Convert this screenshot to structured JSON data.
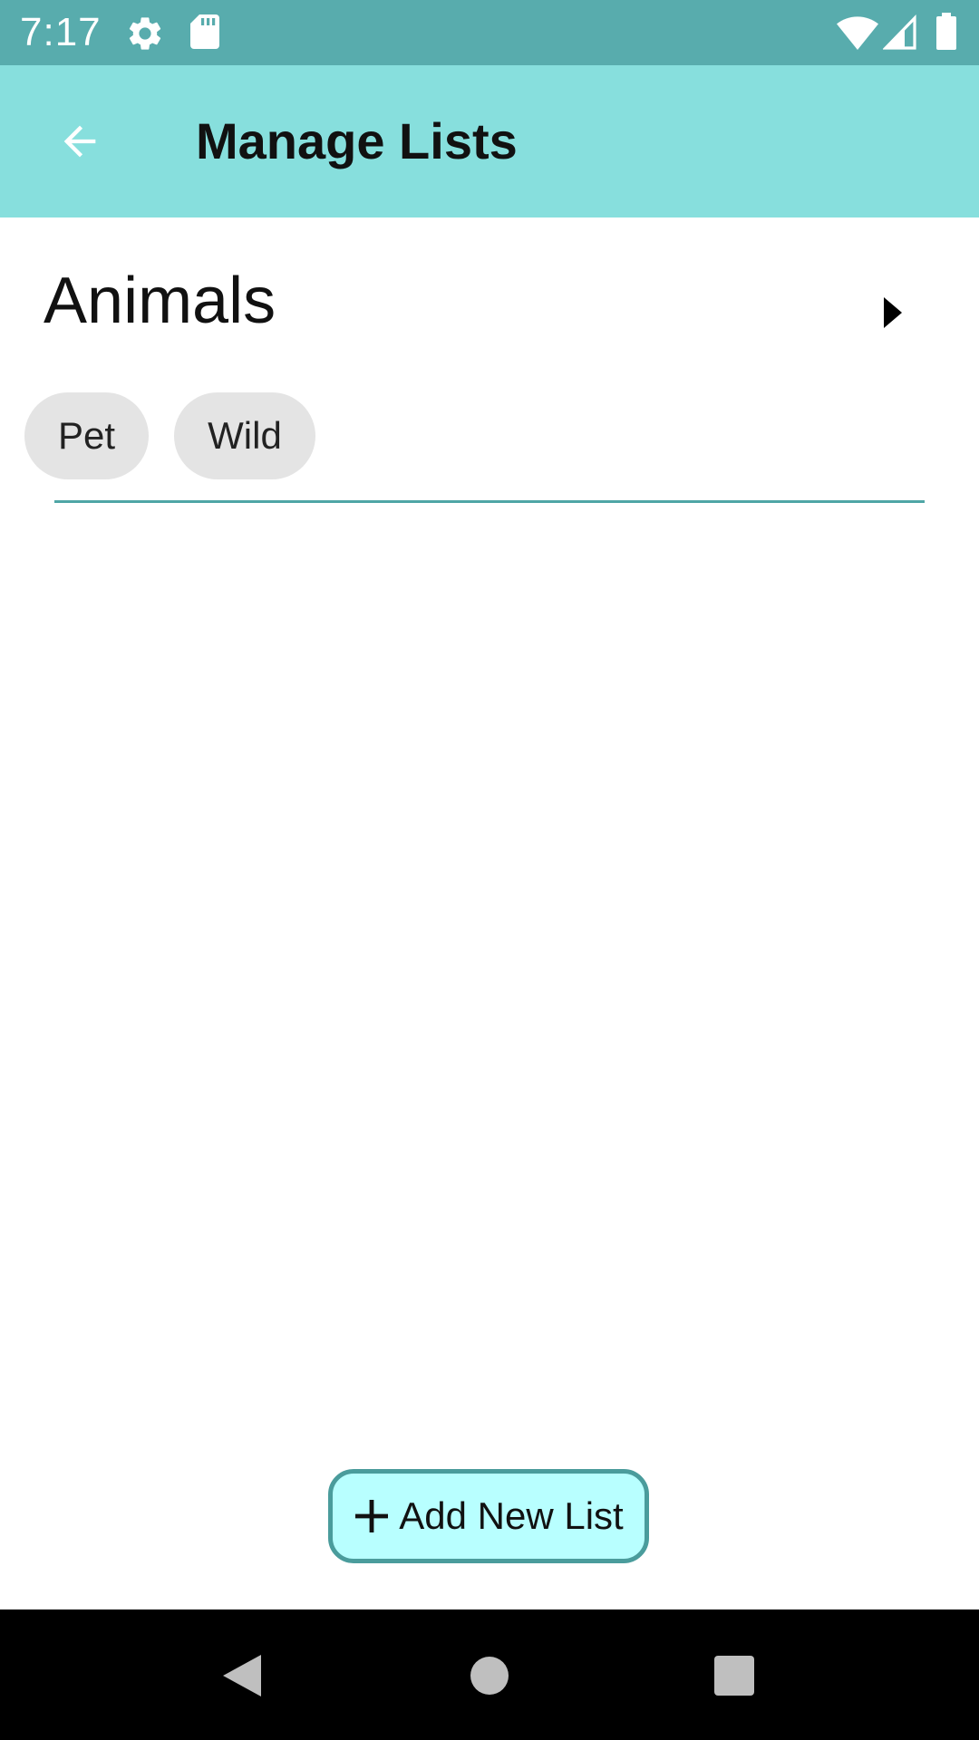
{
  "status_bar": {
    "time": "7:17",
    "icons": [
      "settings-icon",
      "sd-card-icon",
      "wifi-icon",
      "signal-icon",
      "battery-icon"
    ],
    "background": "#58acad"
  },
  "app_bar": {
    "title": "Manage Lists",
    "back_icon": "arrow-back-icon",
    "background": "#87dfdd"
  },
  "lists": [
    {
      "name": "Animals",
      "toggle_icon": "caret-right-icon",
      "chips": [
        "Pet",
        "Wild"
      ]
    }
  ],
  "add_button": {
    "icon": "plus-icon",
    "label": "Add New List",
    "background": "#b8ffff",
    "border": "#4a9c9c"
  },
  "nav_bar": {
    "buttons": [
      "back-triangle-icon",
      "home-circle-icon",
      "recents-square-icon"
    ]
  }
}
